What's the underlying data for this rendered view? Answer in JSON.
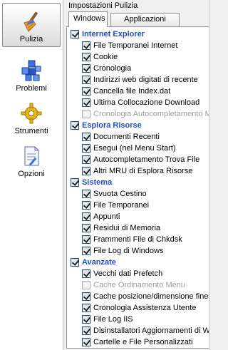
{
  "sidebar": {
    "items": [
      {
        "label": "Pulizia",
        "icon": "broom-icon",
        "active": true
      },
      {
        "label": "Problemi",
        "icon": "registry-cubes-icon",
        "active": false
      },
      {
        "label": "Strumenti",
        "icon": "tools-gear-icon",
        "active": false
      },
      {
        "label": "Opzioni",
        "icon": "options-document-icon",
        "active": false
      }
    ]
  },
  "main": {
    "title": "Impostazioni Pulizia",
    "tabs": [
      {
        "label": "Windows",
        "active": true
      },
      {
        "label": "Applicazioni",
        "active": false
      }
    ],
    "groups": [
      {
        "label": "Internet Explorer",
        "checked": true,
        "items": [
          {
            "label": "File Temporanei Internet",
            "checked": true
          },
          {
            "label": "Cookie",
            "checked": true
          },
          {
            "label": "Cronologia",
            "checked": true
          },
          {
            "label": "Indirizzi web digitati di recente",
            "checked": true
          },
          {
            "label": "Cancella file Index.dat",
            "checked": true
          },
          {
            "label": "Ultima Collocazione Download",
            "checked": true
          },
          {
            "label": "Cronologia Autocompletamento Mod",
            "checked": false,
            "disabled": true
          }
        ]
      },
      {
        "label": "Esplora Risorse",
        "checked": true,
        "items": [
          {
            "label": "Documenti Recenti",
            "checked": true
          },
          {
            "label": "Esegui (nel Menu Start)",
            "checked": true
          },
          {
            "label": "Autocompletamento Trova File",
            "checked": true
          },
          {
            "label": "Altri MRU di Esplora Risorse",
            "checked": true
          }
        ]
      },
      {
        "label": "Sistema",
        "checked": true,
        "items": [
          {
            "label": "Svuota Cestino",
            "checked": true
          },
          {
            "label": "File Temporanei",
            "checked": true
          },
          {
            "label": "Appunti",
            "checked": true
          },
          {
            "label": "Residui di Memoria",
            "checked": true
          },
          {
            "label": "Frammenti File di Chkdsk",
            "checked": true
          },
          {
            "label": "File Log di Windows",
            "checked": true
          }
        ]
      },
      {
        "label": "Avanzate",
        "checked": true,
        "items": [
          {
            "label": "Vecchi dati Prefetch",
            "checked": true
          },
          {
            "label": "Cache Ordinamento Menu",
            "checked": false,
            "disabled": true
          },
          {
            "label": "Cache posizione/dimensione finestre",
            "checked": true
          },
          {
            "label": "Cronologia Assistenza Utente",
            "checked": true
          },
          {
            "label": "File Log IIS",
            "checked": true
          },
          {
            "label": "Disinstallatori Aggiornamenti di WinUp",
            "checked": true
          },
          {
            "label": "Cartelle e File Personalizzati",
            "checked": true
          }
        ]
      }
    ]
  },
  "colors": {
    "group_label": "#1f4fbf",
    "disabled_text": "#a0a0a0",
    "sidebar_bg": "#ffffff",
    "panel_bg": "#f0f0f0"
  }
}
